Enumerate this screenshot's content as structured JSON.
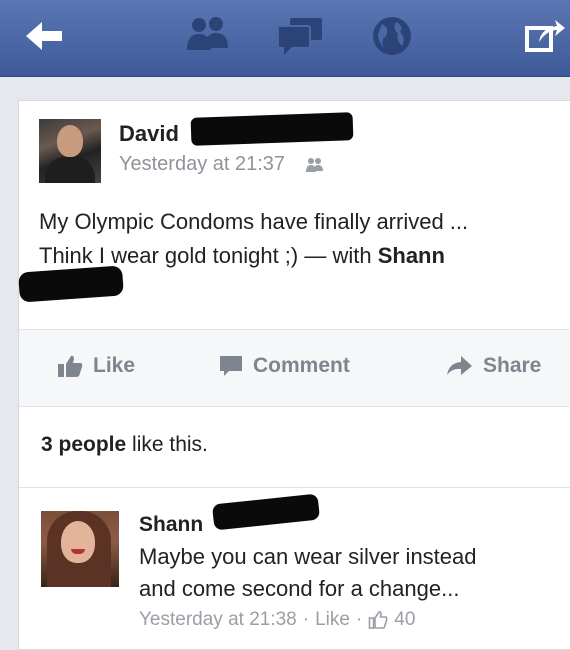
{
  "topbar": {
    "icons": [
      "back-arrow-icon",
      "friend-requests-icon",
      "messages-icon",
      "notifications-globe-icon",
      "share-icon"
    ]
  },
  "post": {
    "author": "David",
    "timestamp": "Yesterday at 21:37",
    "audience_icon": "friends-icon",
    "text_line1": "My Olympic Condoms have finally arrived ...",
    "text_line2_prefix": "Think I wear gold tonight ;) — with ",
    "tagged": "Shann"
  },
  "actions": {
    "like": "Like",
    "comment": "Comment",
    "share": "Share"
  },
  "likes": {
    "count_text": "3 people",
    "suffix": " like this."
  },
  "comment": {
    "author": "Shann",
    "text_line1": "Maybe you can wear silver instead",
    "text_line2": "and come second for a change...",
    "timestamp": "Yesterday at 21:38",
    "sep": "·",
    "like_label": "Like",
    "like_count": "40"
  },
  "colors": {
    "topbar": "#4b67a5",
    "meta_text": "#8f939a",
    "action_text": "#7f858f"
  }
}
